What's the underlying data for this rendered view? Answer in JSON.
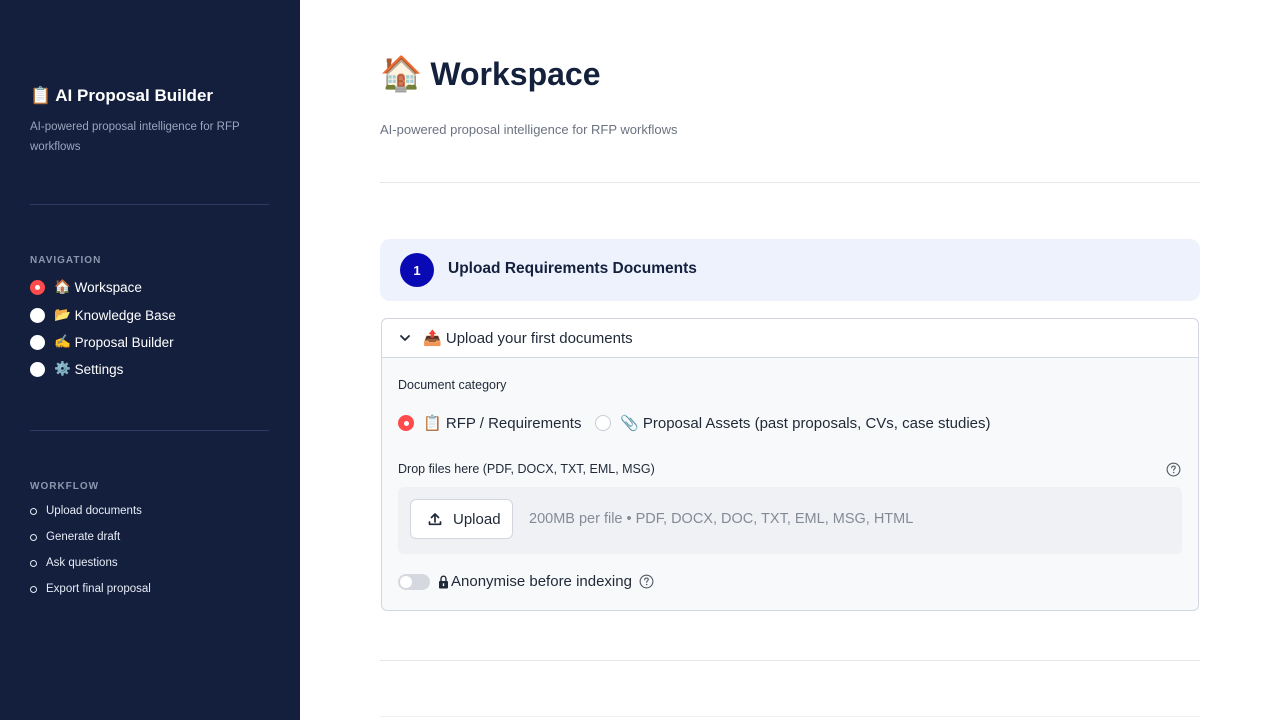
{
  "sidebar": {
    "brand_emoji": "📋",
    "brand_title": "AI Proposal Builder",
    "brand_subtitle": "AI-powered proposal intelligence for RFP workflows",
    "nav_label": "NAVIGATION",
    "nav_items": [
      {
        "emoji": "🏠",
        "label": "Workspace",
        "selected": true
      },
      {
        "emoji": "📂",
        "label": "Knowledge Base",
        "selected": false
      },
      {
        "emoji": "✍️",
        "label": "Proposal Builder",
        "selected": false
      },
      {
        "emoji": "⚙️",
        "label": "Settings",
        "selected": false
      }
    ],
    "workflow_label": "WORKFLOW",
    "workflow_items": [
      "Upload documents",
      "Generate draft",
      "Ask questions",
      "Export final proposal"
    ]
  },
  "main": {
    "title_emoji": "🏠",
    "title": "Workspace",
    "subtitle": "AI-powered proposal intelligence for RFP workflows",
    "step": {
      "number": "1",
      "title": "Upload Requirements Documents"
    },
    "expander": {
      "emoji": "📤",
      "title": "Upload your first documents",
      "category_label": "Document category",
      "category_options": [
        {
          "emoji": "📋",
          "label": "RFP / Requirements",
          "selected": true
        },
        {
          "emoji": "📎",
          "label": "Proposal Assets (past proposals, CVs, case studies)",
          "selected": false
        }
      ],
      "dropzone_label": "Drop files here (PDF, DOCX, TXT, EML, MSG)",
      "upload_label": "Upload",
      "dropzone_hint": "200MB per file • PDF, DOCX, DOC, TXT, EML, MSG, HTML",
      "toggle_label": "Anonymise before indexing",
      "toggle_on": false
    }
  },
  "colors": {
    "sidebar_bg": "#131f3d",
    "accent": "#ff4b4b",
    "step_badge": "#0a0ab4",
    "step_card_bg": "#edf2fd"
  }
}
